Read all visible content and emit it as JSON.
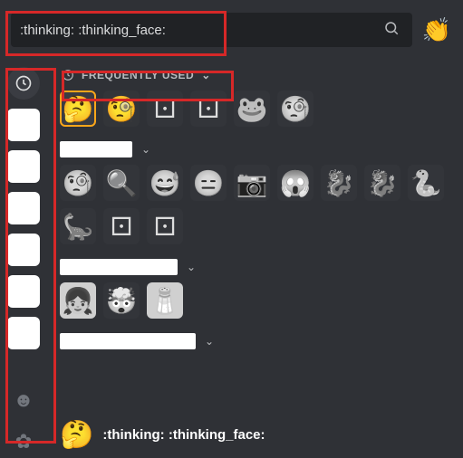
{
  "search": {
    "value": ":thinking: :thinking_face:",
    "placeholder": ":thinking: :thinking_face:"
  },
  "skin_tone_glyph": "👏",
  "section": {
    "title": "FREQUENTLY USED"
  },
  "frequently_used": [
    {
      "glyph": "🤔",
      "name": "thinking",
      "selected": true,
      "color": true
    },
    {
      "glyph": "🧐",
      "name": "monocle",
      "color": true
    },
    {
      "glyph": "⚀",
      "name": "d20-a"
    },
    {
      "glyph": "⚀",
      "name": "d20-b"
    },
    {
      "glyph": "🐸",
      "name": "frog"
    },
    {
      "glyph": "🧐",
      "name": "monocle-2"
    }
  ],
  "server1": {
    "label_width": 80,
    "emojis": [
      {
        "glyph": "🧐",
        "name": "monocle"
      },
      {
        "glyph": "🔍",
        "name": "face-zoom"
      },
      {
        "glyph": "😅",
        "name": "sweat-smile"
      },
      {
        "glyph": "😑",
        "name": "neutral"
      },
      {
        "glyph": "📷",
        "name": "camera-blur"
      },
      {
        "glyph": "😱",
        "name": "scream"
      },
      {
        "glyph": "🐉",
        "name": "dragon-text"
      },
      {
        "glyph": "🐉",
        "name": "dragon"
      },
      {
        "glyph": "🐍",
        "name": "serpent"
      },
      {
        "glyph": "🦕",
        "name": "sauropod"
      },
      {
        "glyph": "⚀",
        "name": "d20-c"
      },
      {
        "glyph": "⚀",
        "name": "d20-d"
      }
    ]
  },
  "server2": {
    "label_width": 130,
    "emojis": [
      {
        "glyph": "👧",
        "name": "avatar",
        "pix": true
      },
      {
        "glyph": "🤯",
        "name": "exploding-head"
      },
      {
        "glyph": "🧂",
        "name": "salt",
        "pix": true
      }
    ]
  },
  "server3": {
    "label_width": 150,
    "emojis": []
  },
  "preview": {
    "glyph": "🤔",
    "code": ":thinking: :thinking_face:"
  }
}
